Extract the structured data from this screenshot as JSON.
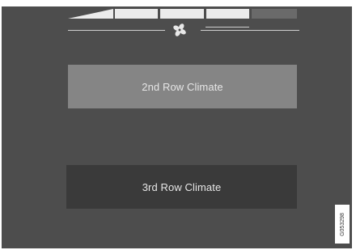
{
  "fan": {
    "icon": "fan-icon",
    "level": 0.75
  },
  "buttons": {
    "second_row": "2nd Row Climate",
    "third_row": "3rd Row Climate"
  },
  "figure_code": "G053298",
  "colors": {
    "screen": "#4d4d4d",
    "active_button": "#858585",
    "inactive_button": "#3a3a3a",
    "fan_bar": "#ebebeb"
  }
}
